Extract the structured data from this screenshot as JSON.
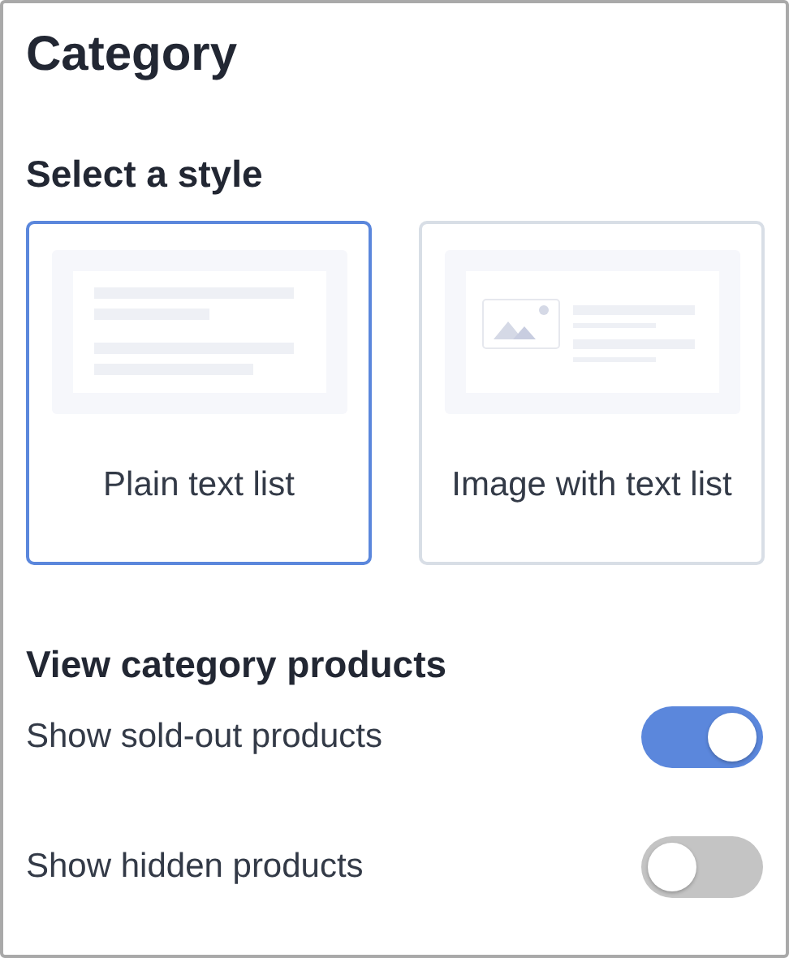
{
  "title": "Category",
  "style_section": {
    "heading": "Select a style",
    "options": [
      {
        "kind": "plain",
        "label": "Plain text list",
        "selected": true
      },
      {
        "kind": "image",
        "label": "Image with text list",
        "selected": false
      }
    ]
  },
  "products_section": {
    "heading": "View category products",
    "toggles": [
      {
        "label": "Show sold-out products",
        "on": true
      },
      {
        "label": "Show hidden products",
        "on": false
      }
    ]
  }
}
